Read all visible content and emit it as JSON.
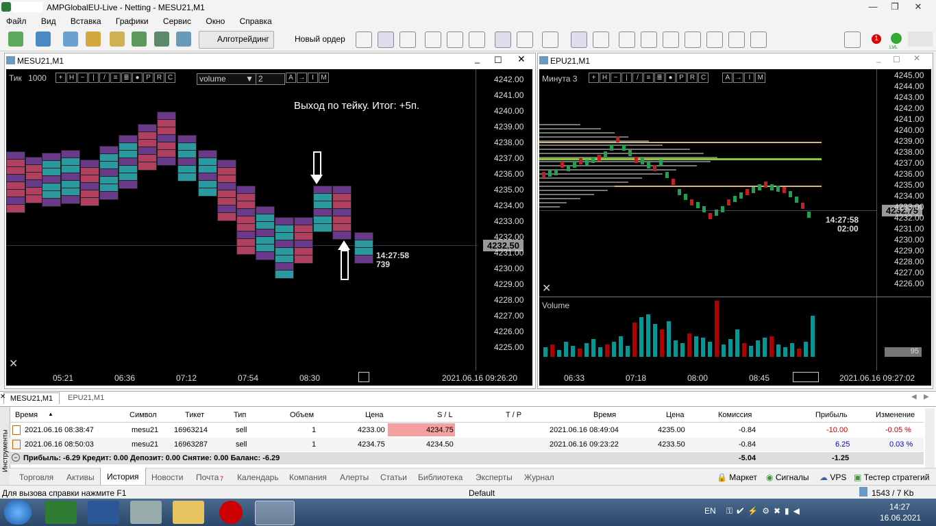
{
  "window": {
    "title": "AMPGlobalEU-Live - Netting - MESU21,M1"
  },
  "menu": [
    "Файл",
    "Вид",
    "Вставка",
    "Графики",
    "Сервис",
    "Окно",
    "Справка"
  ],
  "toolbar": {
    "algo": "Алготрейдинг",
    "new_order": "Новый ордер"
  },
  "notifications": {
    "badge": "1",
    "lvl": "LVL"
  },
  "chart1": {
    "title": "MESU21,M1",
    "mode": "Тик",
    "ticks": "1000",
    "indicator": "volume",
    "depth": "2",
    "annotation": "Выход по тейку. Итог: +5п.",
    "prices": [
      "4242.00",
      "4241.00",
      "4240.00",
      "4239.00",
      "4238.00",
      "4237.00",
      "4236.00",
      "4235.00",
      "4234.00",
      "4233.00",
      "4232.00",
      "4231.00",
      "4230.00",
      "4229.00",
      "4228.00",
      "4227.00",
      "4226.00",
      "4225.00"
    ],
    "current_price": "4232.50",
    "time_left": "14:27:58",
    "ticks_left": "739",
    "times": [
      "05:21",
      "06:36",
      "07:12",
      "07:54",
      "08:30"
    ],
    "datetime": "2021.06.16 09:26:20"
  },
  "chart2": {
    "title": "EPU21,M1",
    "mode": "Минута",
    "period": "3",
    "prices": [
      "4245.00",
      "4244.00",
      "4243.00",
      "4242.00",
      "4241.00",
      "4240.00",
      "4239.00",
      "4238.00",
      "4237.00",
      "4236.00",
      "4235.00",
      "4234.00",
      "4233.00",
      "4232.00",
      "4231.00",
      "4230.00",
      "4229.00",
      "4228.00",
      "4227.00",
      "4226.00"
    ],
    "current_price": "4232.75",
    "time_left": "14:27:58",
    "time_left2": "02:00",
    "volume_label": "Volume",
    "volume_value": "95",
    "times": [
      "06:33",
      "07:18",
      "08:00",
      "08:45"
    ],
    "datetime": "2021.06.16 09:27:02"
  },
  "tabs": {
    "chart_tabs": [
      "MESU21,M1",
      "EPU21,M1"
    ]
  },
  "history": {
    "headers": [
      "Время",
      "Символ",
      "Тикет",
      "Тип",
      "Объем",
      "Цена",
      "S / L",
      "T / P",
      "Время",
      "Цена",
      "Комиссия",
      "Прибыль",
      "Изменение"
    ],
    "rows": [
      [
        "2021.06.16 08:38:47",
        "mesu21",
        "16963214",
        "sell",
        "1",
        "4233.00",
        "4234.75",
        "",
        "2021.06.16 08:49:04",
        "4235.00",
        "-0.84",
        "-10.00",
        "-0.05 %"
      ],
      [
        "2021.06.16 08:50:03",
        "mesu21",
        "16963287",
        "sell",
        "1",
        "4234.75",
        "4234.50",
        "",
        "2021.06.16 09:23:22",
        "4233.50",
        "-0.84",
        "6.25",
        "0.03 %"
      ]
    ],
    "summary": "Прибыль: -6.29  Кредит: 0.00  Депозит: 0.00  Снятие: 0.00  Баланс: -6.29",
    "summary_commission": "-5.04",
    "summary_profit": "-1.25",
    "side_label": "Инструменты"
  },
  "bottom_tabs": [
    "Торговля",
    "Активы",
    "История",
    "Новости",
    "Почта",
    "Календарь",
    "Компания",
    "Алерты",
    "Статьи",
    "Библиотека",
    "Эксперты",
    "Журнал"
  ],
  "mail_count": "7",
  "right_tabs": [
    "Маркет",
    "Сигналы",
    "VPS",
    "Тестер стратегий"
  ],
  "status": {
    "help": "Для вызова справки нажмите F1",
    "profile": "Default",
    "traffic": "1543 / 7 Kb"
  },
  "tray": {
    "lang": "EN",
    "time": "14:27",
    "date": "16.06.2021"
  },
  "colors": {
    "loss": "#cc0000",
    "profit": "#0000cc",
    "sl_highlight": "#f4a0a0",
    "volume_up": "#009999",
    "volume_down": "#b00000"
  }
}
